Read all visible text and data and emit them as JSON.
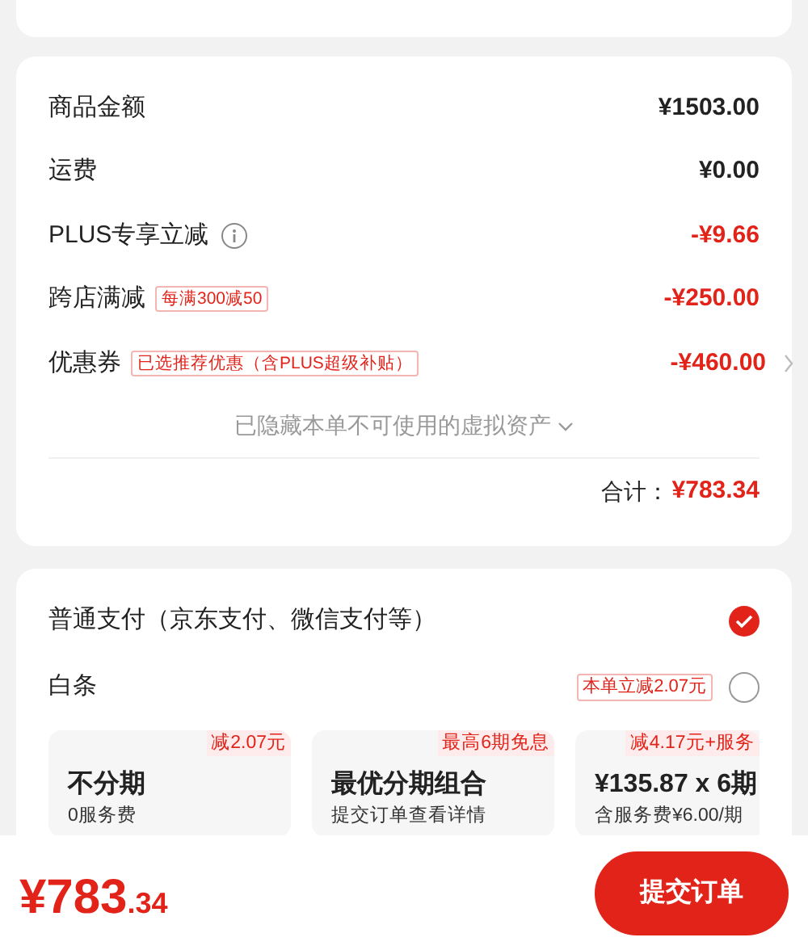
{
  "summary": {
    "rows": [
      {
        "label": "商品金额",
        "amount": "¥1503.00",
        "discount": false
      },
      {
        "label": "运费",
        "amount": "¥0.00",
        "discount": false
      },
      {
        "label": "PLUS专享立减",
        "info": true,
        "amount": "-¥9.66",
        "discount": true
      },
      {
        "label": "跨店满减",
        "tag": "每满300减50",
        "amount": "-¥250.00",
        "discount": true
      },
      {
        "label": "优惠券",
        "tag": "已选推荐优惠（含PLUS超级补贴）",
        "amount": "-¥460.00",
        "discount": true,
        "chevron": true
      }
    ],
    "hidden_note": "已隐藏本单不可使用的虚拟资产",
    "total_label": "合计：",
    "total": "¥783.34"
  },
  "payment": {
    "methods": [
      {
        "label": "普通支付（京东支付、微信支付等）",
        "selected": true
      },
      {
        "label": "白条",
        "badge": "本单立减2.07元",
        "selected": false
      }
    ],
    "plans": [
      {
        "corner": "减2.07元",
        "title": "不分期",
        "sub": "0服务费"
      },
      {
        "corner": "最高6期免息",
        "title": "最优分期组合",
        "sub": "提交订单查看详情"
      },
      {
        "corner": "减4.17元+服务",
        "title": "¥135.87 x 6期",
        "sub": "含服务费¥6.00/期"
      }
    ]
  },
  "footer": {
    "price_main": "¥783",
    "price_decimal": ".34",
    "submit": "提交订单"
  }
}
